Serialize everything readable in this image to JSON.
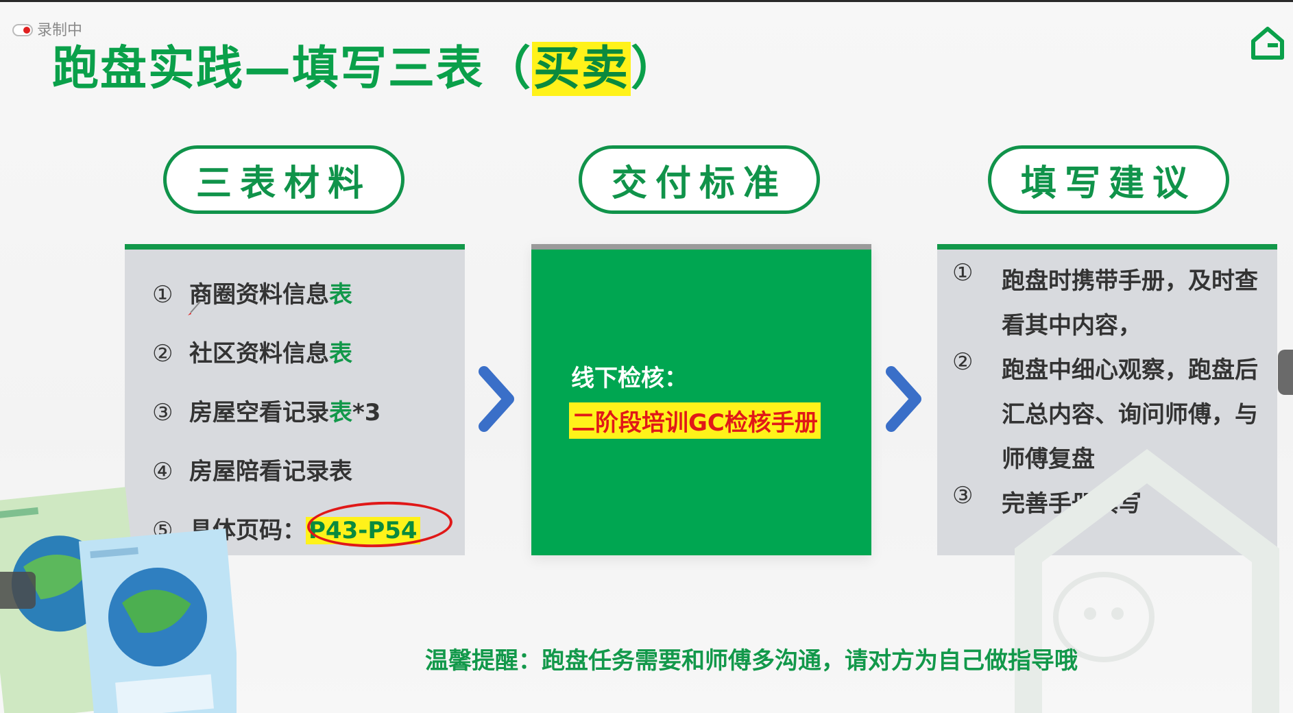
{
  "recording": {
    "label": "录制中"
  },
  "title": {
    "main": "跑盘实践—填写三表（",
    "highlight": "买卖",
    "end": "）"
  },
  "sections": [
    {
      "label": "三表材料"
    },
    {
      "label": "交付标准"
    },
    {
      "label": "填写建议"
    }
  ],
  "materials": [
    {
      "num": "①",
      "text": "商圈资料信息",
      "suffix": "表"
    },
    {
      "num": "②",
      "text": "社区资料信息",
      "suffix": "表"
    },
    {
      "num": "③",
      "text": "房屋空看记录",
      "suffix": "表",
      "extra": "*3"
    },
    {
      "num": "④",
      "text": "房屋陪看记录表"
    },
    {
      "num": "⑤",
      "text": "具体页码：",
      "pages": "P43-P54"
    }
  ],
  "delivery": {
    "label": "线下检核：",
    "manual": "二阶段培训GC检核手册"
  },
  "suggestions": [
    {
      "num": "①",
      "text": "跑盘时携带手册，及时查看其中内容，"
    },
    {
      "num": "②",
      "text": "跑盘中细心观察，跑盘后汇总内容、询问师傅，与师傅复盘"
    },
    {
      "num": "③",
      "text": "完善手册填写"
    }
  ],
  "tip": {
    "text": "温馨提醒：跑盘任务需要和师傅多沟通，请对方为自己做指导哦"
  },
  "colors": {
    "green": "#12984a",
    "card_gray": "#d8dade",
    "card_green": "#00a651",
    "highlight": "#fff21a",
    "arrow": "#3a6fc8",
    "red": "#e01818"
  },
  "icons": {
    "home": "home-icon",
    "arrow": "chevron-right-icon",
    "recording": "recording-icon"
  }
}
